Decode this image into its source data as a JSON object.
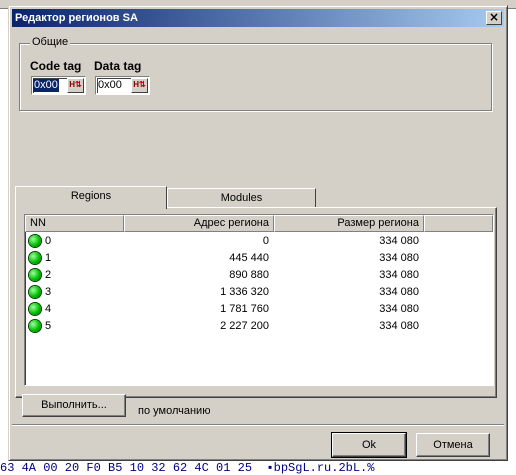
{
  "window": {
    "title": "Редактор регионов SA"
  },
  "group": {
    "legend": "Общие",
    "code_tag": {
      "label": "Code tag",
      "value": "0x00"
    },
    "data_tag": {
      "label": "Data tag",
      "value": "0x00"
    },
    "spin_label": "H"
  },
  "tabs": [
    {
      "label": "Regions",
      "active": true
    },
    {
      "label": "Modules",
      "active": false
    }
  ],
  "list": {
    "columns": [
      "NN",
      "Адрес региона",
      "Размер региона"
    ],
    "rows": [
      {
        "nn": "0",
        "address": "0",
        "size": "334 080",
        "status": "green"
      },
      {
        "nn": "1",
        "address": "445 440",
        "size": "334 080",
        "status": "green"
      },
      {
        "nn": "2",
        "address": "890 880",
        "size": "334 080",
        "status": "green"
      },
      {
        "nn": "3",
        "address": "1 336 320",
        "size": "334 080",
        "status": "green"
      },
      {
        "nn": "4",
        "address": "1 781 760",
        "size": "334 080",
        "status": "green"
      },
      {
        "nn": "5",
        "address": "2 227 200",
        "size": "334 080",
        "status": "green"
      }
    ]
  },
  "actions": {
    "execute_label": "Выполнить...",
    "default_note": "по умолчанию",
    "ok_label": "Ok",
    "cancel_label": "Отмена"
  },
  "background": {
    "hex_line": "63 4A 00 20 F0 B5 10 32 62 4C 01 25  ▪bpSgL.ru.2bL.%"
  },
  "colors": {
    "titlebar_start": "#0a246a",
    "titlebar_end": "#a6caf0",
    "status_green": "#00c000",
    "face": "#d4d0c8"
  }
}
